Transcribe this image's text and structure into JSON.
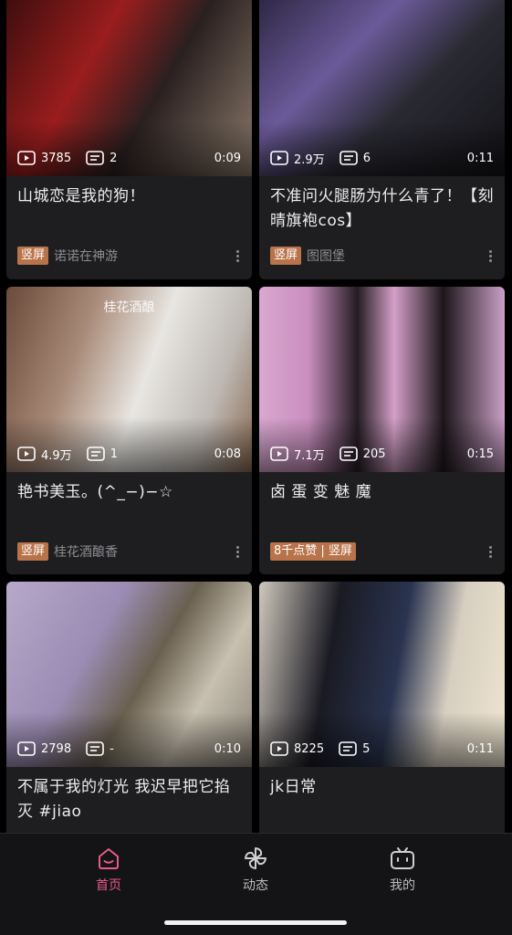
{
  "feed": {
    "cards": [
      {
        "plays": "3785",
        "comments": "2",
        "duration": "0:09",
        "title": "山城恋是我的狗！",
        "badge": "竖屏",
        "author": "诺诺在神游",
        "watermark": ""
      },
      {
        "plays": "2.9万",
        "comments": "6",
        "duration": "0:11",
        "title": "不准问火腿肠为什么青了！【刻晴旗袍cos】",
        "badge": "竖屏",
        "author": "图图堡",
        "watermark": ""
      },
      {
        "plays": "4.9万",
        "comments": "1",
        "duration": "0:08",
        "title": "艳书美玉。(^_−)−☆",
        "badge": "竖屏",
        "author": "桂花酒酿香",
        "watermark": "桂花酒酿"
      },
      {
        "plays": "7.1万",
        "comments": "205",
        "duration": "0:15",
        "title": "卤 蛋 变 魅 魔",
        "badge": "8千点赞 | 竖屏",
        "author": "",
        "watermark": ""
      },
      {
        "plays": "2798",
        "comments": "-",
        "duration": "0:10",
        "title": "不属于我的灯光 我迟早把它掐灭 #jiao",
        "badge": "",
        "author": "",
        "watermark": ""
      },
      {
        "plays": "8225",
        "comments": "5",
        "duration": "0:11",
        "title": "jk日常",
        "badge": "",
        "author": "",
        "watermark": ""
      }
    ]
  },
  "tabbar": {
    "home": "首页",
    "dynamic": "动态",
    "mine": "我的"
  },
  "colors": {
    "accent": "#e75a86",
    "badge": "#b9734a",
    "card": "#1e1e20"
  }
}
